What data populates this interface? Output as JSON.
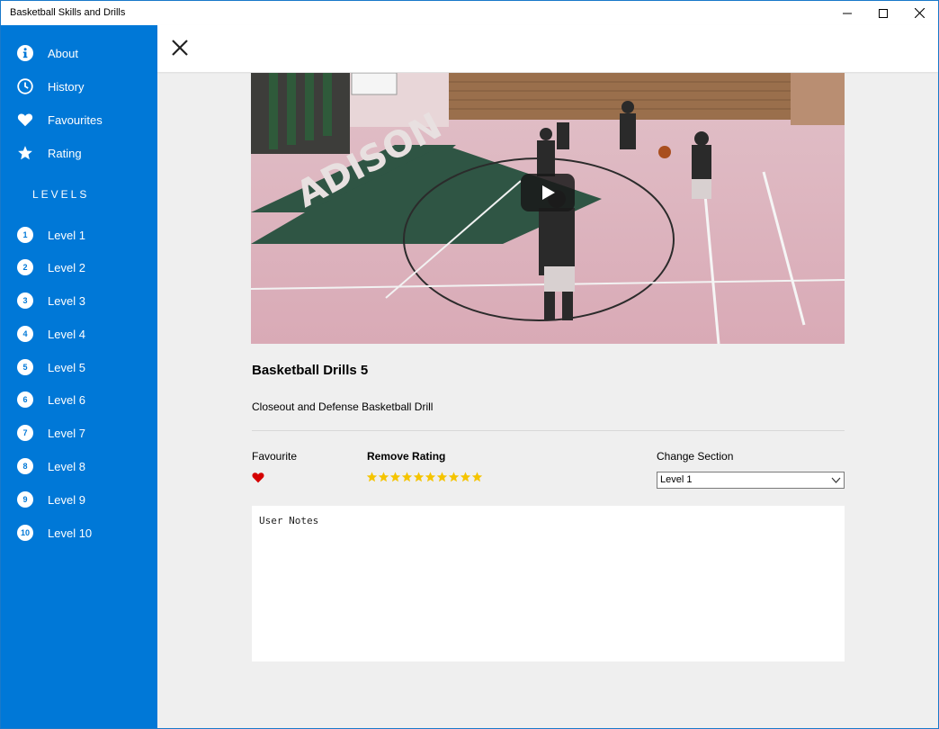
{
  "window": {
    "title": "Basketball Skills and Drills"
  },
  "sidebar": {
    "items": [
      {
        "label": "About",
        "icon": "info-icon"
      },
      {
        "label": "History",
        "icon": "clock-icon"
      },
      {
        "label": "Favourites",
        "icon": "heart-icon"
      },
      {
        "label": "Rating",
        "icon": "star-icon"
      }
    ],
    "levels_heading": "LEVELS",
    "levels": [
      {
        "num": "1",
        "label": "Level 1"
      },
      {
        "num": "2",
        "label": "Level 2"
      },
      {
        "num": "3",
        "label": "Level 3"
      },
      {
        "num": "4",
        "label": "Level 4"
      },
      {
        "num": "5",
        "label": "Level 5"
      },
      {
        "num": "6",
        "label": "Level 6"
      },
      {
        "num": "7",
        "label": "Level 7"
      },
      {
        "num": "8",
        "label": "Level 8"
      },
      {
        "num": "9",
        "label": "Level 9"
      },
      {
        "num": "10",
        "label": "Level 10"
      }
    ]
  },
  "detail": {
    "title": "Basketball Drills 5",
    "description": "Closeout and Defense Basketball Drill",
    "favourite_label": "Favourite",
    "remove_rating_label": "Remove Rating",
    "rating": 10,
    "rating_max": 10,
    "change_section_label": "Change Section",
    "section_value": "Level 1",
    "notes_placeholder": "User Notes",
    "court_text": "ADISON"
  },
  "colors": {
    "accent": "#0078d7",
    "star": "#f5c400",
    "heart": "#d50000",
    "background": "#efefef"
  }
}
